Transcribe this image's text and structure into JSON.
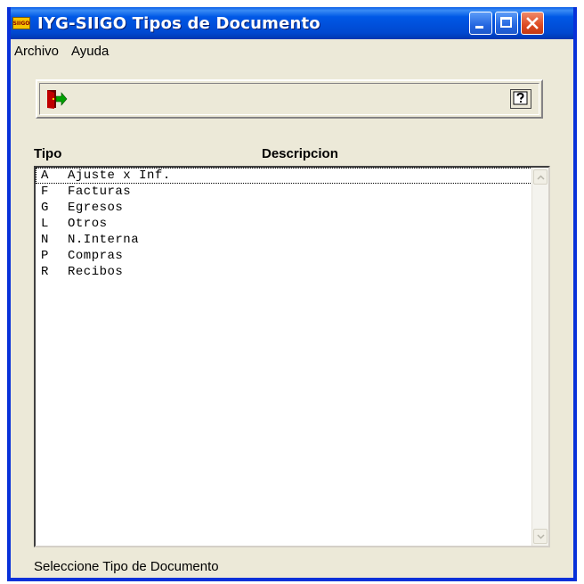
{
  "window": {
    "title": "IYG-SIIGO Tipos de Documento",
    "app_icon_text": "SIIGO"
  },
  "menu": {
    "items": [
      "Archivo",
      "Ayuda"
    ]
  },
  "toolbar": {
    "exit_icon": "exit-door-icon",
    "help_icon": "help-question-icon"
  },
  "list": {
    "headers": {
      "tipo": "Tipo",
      "descripcion": "Descripcion"
    },
    "rows": [
      {
        "code": "A",
        "desc": "Ajuste x Inf."
      },
      {
        "code": "F",
        "desc": "Facturas"
      },
      {
        "code": "G",
        "desc": "Egresos"
      },
      {
        "code": "L",
        "desc": "Otros"
      },
      {
        "code": "N",
        "desc": "N.Interna"
      },
      {
        "code": "P",
        "desc": "Compras"
      },
      {
        "code": "R",
        "desc": "Recibos"
      }
    ],
    "selected_index": 0
  },
  "status": {
    "text": "Seleccione Tipo de Documento"
  },
  "colors": {
    "titlebar": "#0054e3",
    "window_bg": "#ece9d8",
    "frame": "#0831d9"
  }
}
